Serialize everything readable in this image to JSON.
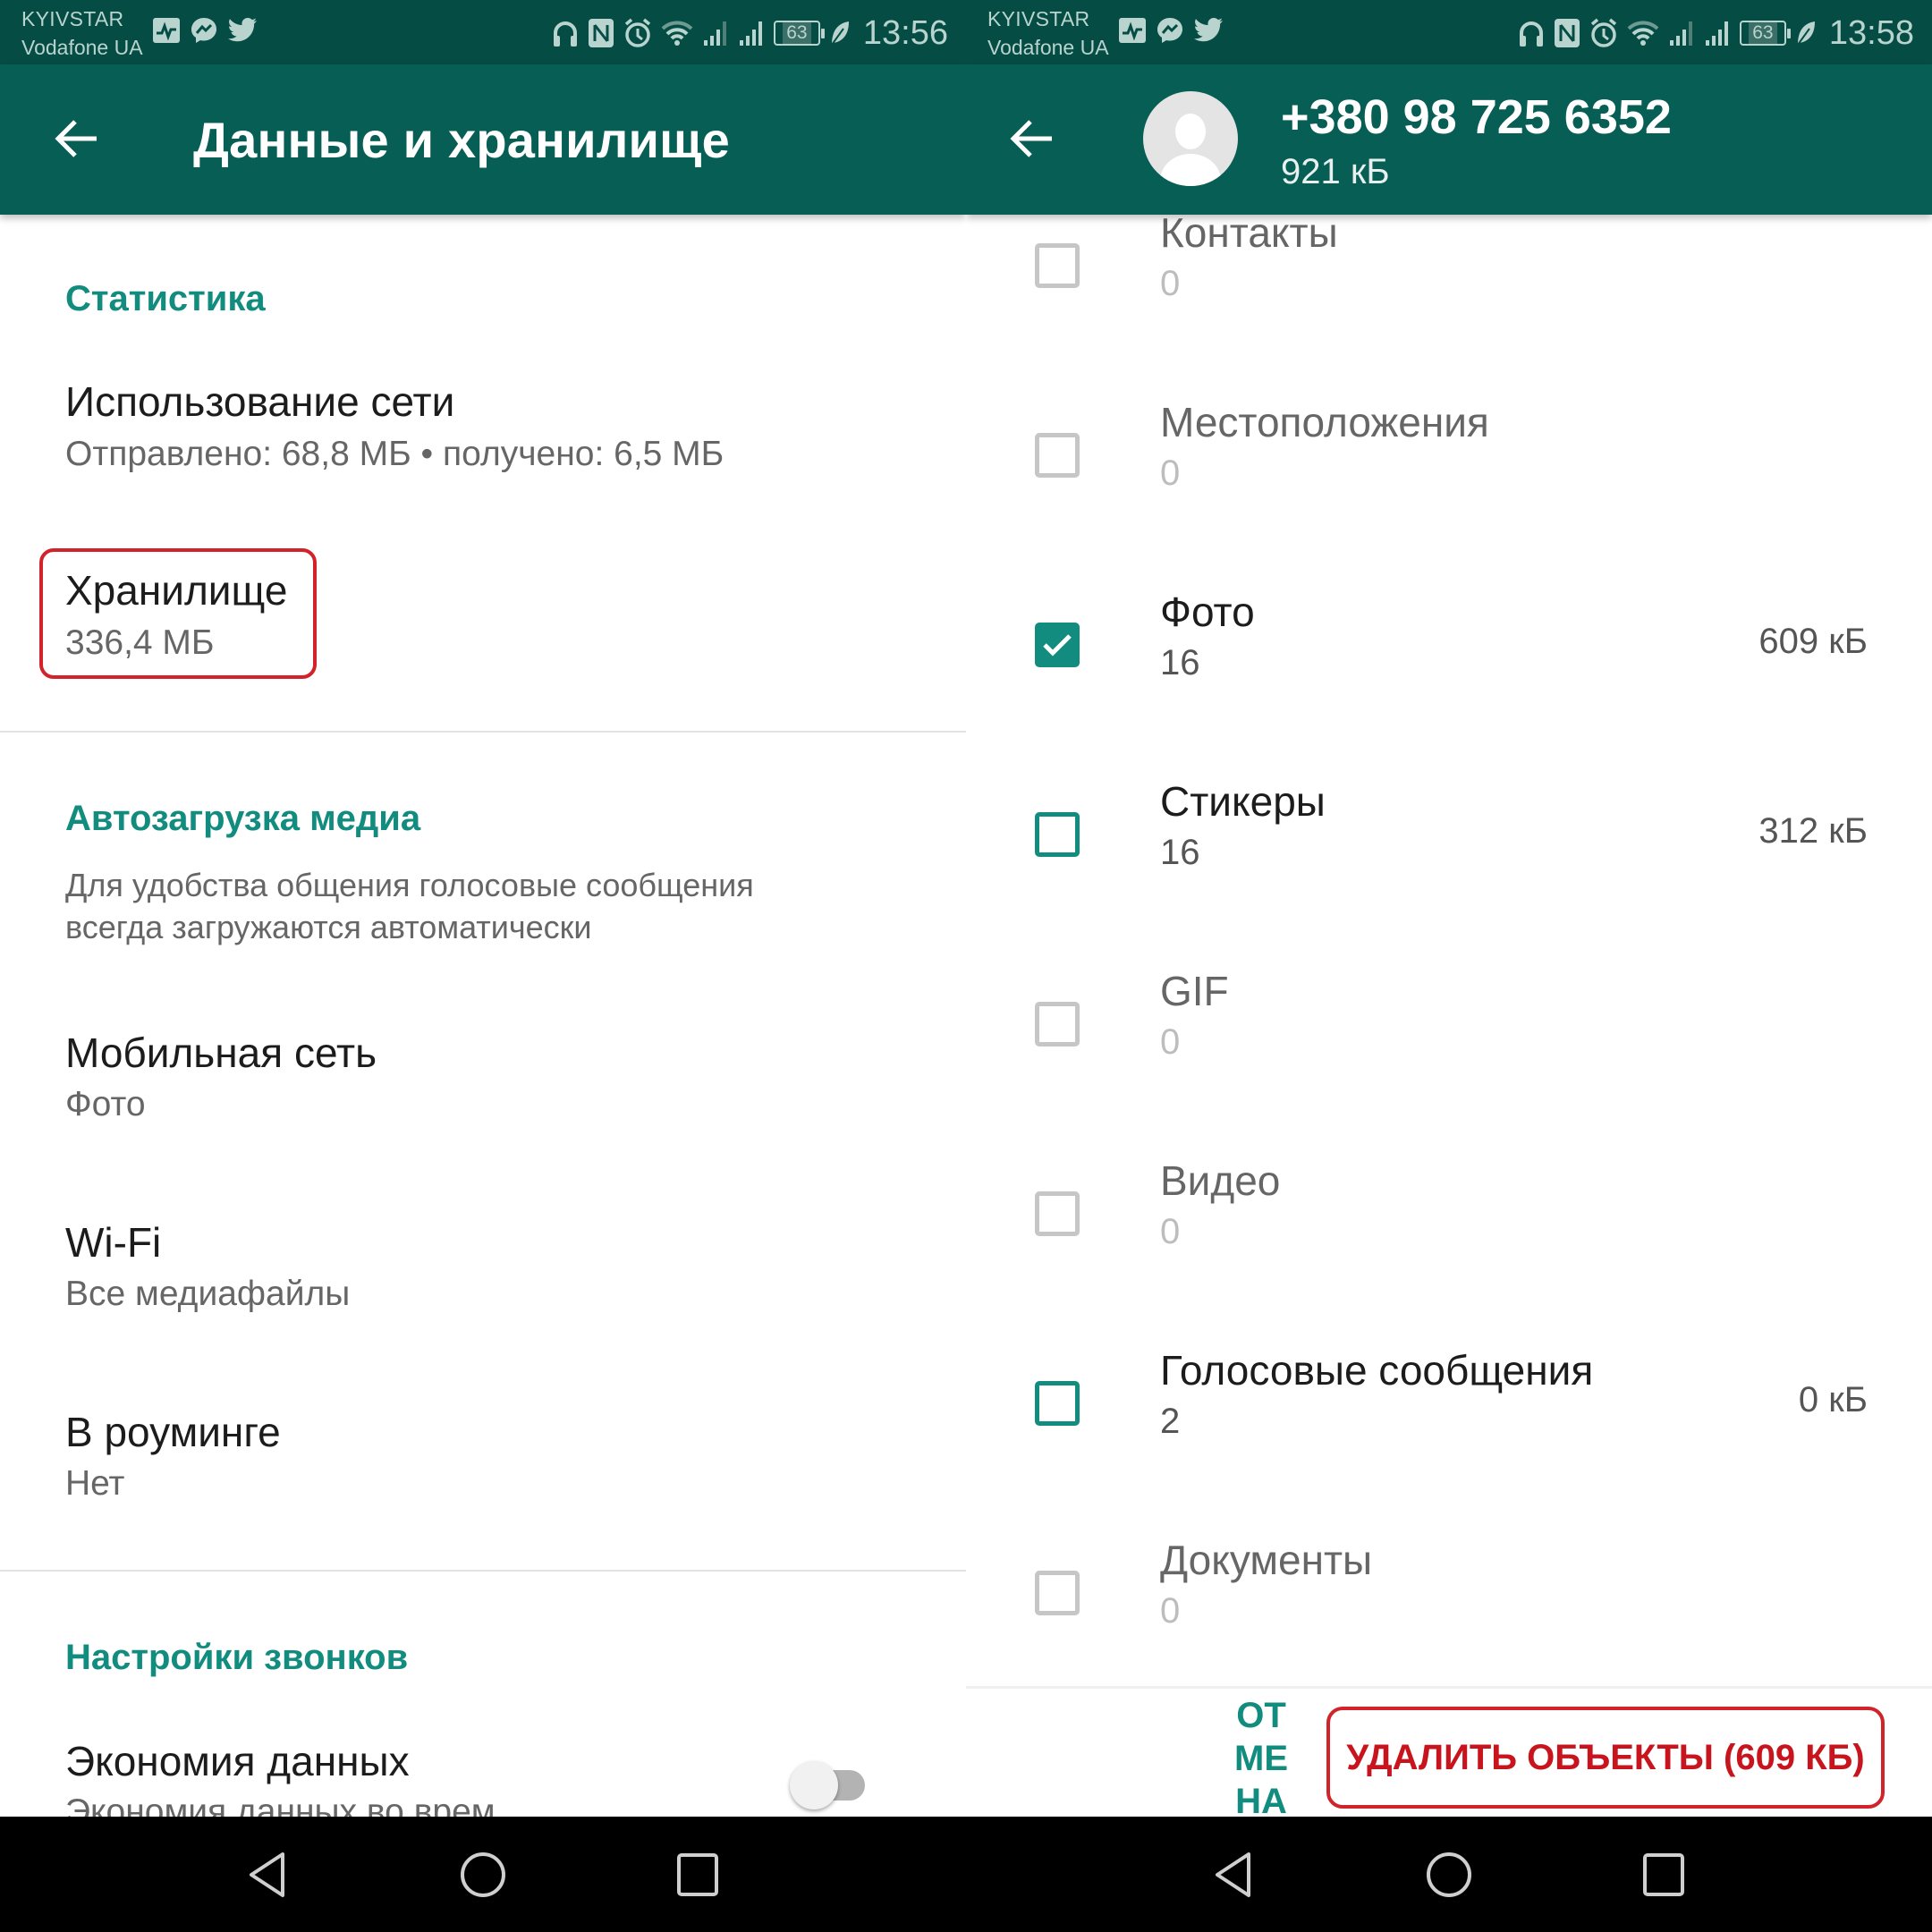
{
  "colors": {
    "status_bar": "#054d44",
    "toolbar": "#075e54",
    "accent": "#128c7e",
    "highlight_red": "#d2232a"
  },
  "left": {
    "status_bar": {
      "carrier_1": "KYIVSTAR",
      "carrier_2": "Vodafone UA",
      "left_icons": [
        "pulse-app-icon",
        "messenger-icon",
        "twitter-icon"
      ],
      "right_icons": [
        "headphones-icon",
        "nfc-icon",
        "alarm-icon",
        "wifi-icon",
        "signal-icon",
        "signal-icon"
      ],
      "battery": "63",
      "time": "13:56"
    },
    "toolbar": {
      "title": "Данные и хранилище"
    },
    "sections": {
      "stats_header": "Статистика",
      "network_usage_title": "Использование сети",
      "network_usage_sub": "Отправлено: 68,8 МБ • получено: 6,5 МБ",
      "storage_title": "Хранилище",
      "storage_sub": "336,4 МБ",
      "autoload_header": "Автозагрузка медиа",
      "autoload_desc_1": "Для удобства общения голосовые сообщения",
      "autoload_desc_2": "всегда загружаются автоматически",
      "mobile_title": "Мобильная сеть",
      "mobile_sub": "Фото",
      "wifi_title": "Wi-Fi",
      "wifi_sub": "Все медиафайлы",
      "roaming_title": "В роуминге",
      "roaming_sub": "Нет",
      "calls_header": "Настройки звонков",
      "datasave_title": "Экономия данных",
      "datasave_sub": "Экономия данных во врем",
      "datasave_on": false
    }
  },
  "right": {
    "status_bar": {
      "carrier_1": "KYIVSTAR",
      "carrier_2": "Vodafone UA",
      "battery": "63",
      "time": "13:58"
    },
    "header": {
      "phone": "+380 98 725 6352",
      "total_size": "921 кБ"
    },
    "items": [
      {
        "title": "Контакты",
        "count": "0",
        "size": "",
        "state": "disabled"
      },
      {
        "title": "Местоположения",
        "count": "0",
        "size": "",
        "state": "disabled"
      },
      {
        "title": "Фото",
        "count": "16",
        "size": "609 кБ",
        "state": "checked"
      },
      {
        "title": "Стикеры",
        "count": "16",
        "size": "312 кБ",
        "state": "unchecked"
      },
      {
        "title": "GIF",
        "count": "0",
        "size": "",
        "state": "disabled"
      },
      {
        "title": "Видео",
        "count": "0",
        "size": "",
        "state": "disabled"
      },
      {
        "title": "Голосовые сообщения",
        "count": "2",
        "size": "0 кБ",
        "state": "unchecked"
      },
      {
        "title": "Документы",
        "count": "0",
        "size": "",
        "state": "disabled"
      }
    ],
    "actions": {
      "cancel_lines": [
        "ОТ",
        "МЕ",
        "НА"
      ],
      "delete_label": "УДАЛИТЬ ОБЪЕКТЫ (609 КБ)"
    }
  }
}
